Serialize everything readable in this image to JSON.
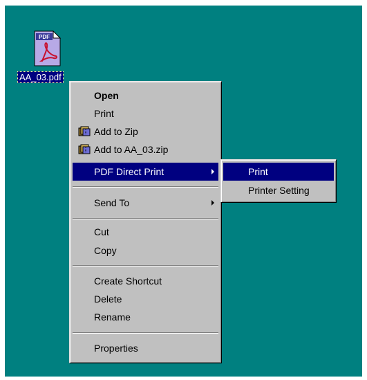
{
  "desktop": {
    "file": {
      "name": "AA_03.pdf",
      "icon": "pdf-file-icon",
      "icon_badge": "PDF"
    }
  },
  "context_menu": {
    "items": [
      {
        "label": "Open",
        "bold": true
      },
      {
        "label": "Print"
      },
      {
        "label": "Add to Zip",
        "icon": "winzip-icon"
      },
      {
        "label": "Add to AA_03.zip",
        "icon": "winzip-icon"
      },
      {
        "label": "PDF Direct Print",
        "submenu": true,
        "selected": true
      },
      {
        "label": "Send To",
        "submenu": true
      },
      {
        "label": "Cut"
      },
      {
        "label": "Copy"
      },
      {
        "label": "Create Shortcut"
      },
      {
        "label": "Delete"
      },
      {
        "label": "Rename"
      },
      {
        "label": "Properties"
      }
    ]
  },
  "submenu": {
    "items": [
      {
        "label": "Print",
        "selected": true
      },
      {
        "label": "Printer Setting"
      }
    ]
  },
  "colors": {
    "desktop": "#008080",
    "menu_face": "#c0c0c0",
    "highlight": "#000080",
    "highlight_text": "#ffffff"
  }
}
